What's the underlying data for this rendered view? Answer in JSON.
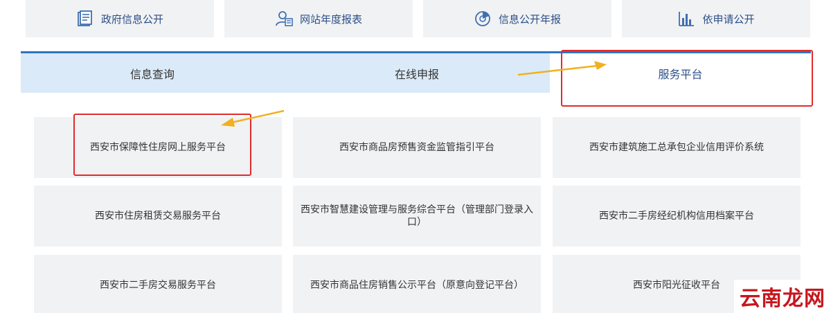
{
  "top_cards": [
    {
      "label": "政府信息公开",
      "icon": "document-icon"
    },
    {
      "label": "网站年度报表",
      "icon": "user-card-icon"
    },
    {
      "label": "信息公开年报",
      "icon": "chart-dial-icon"
    },
    {
      "label": "依申请公开",
      "icon": "bar-chart-icon"
    }
  ],
  "tabs": [
    {
      "label": "信息查询",
      "active": false
    },
    {
      "label": "在线申报",
      "active": false
    },
    {
      "label": "服务平台",
      "active": true
    }
  ],
  "platforms": [
    "西安市保障性住房网上服务平台",
    "西安市商品房预售资金监管指引平台",
    "西安市建筑施工总承包企业信用评价系统",
    "西安市住房租赁交易服务平台",
    "西安市智慧建设管理与服务综合平台（管理部门登录入口）",
    "西安市二手房经纪机构信用档案平台",
    "西安市二手房交易服务平台",
    "西安市商品住房销售公示平台（原意向登记平台）",
    "西安市阳光征收平台"
  ],
  "watermark": "云南龙网",
  "colors": {
    "accent": "#2f74c0",
    "tab_bg": "#dbeaf8",
    "card_bg": "#f1f2f4",
    "highlight": "#e02b2b",
    "arrow": "#f2b01e",
    "watermark": "#c8161d"
  }
}
